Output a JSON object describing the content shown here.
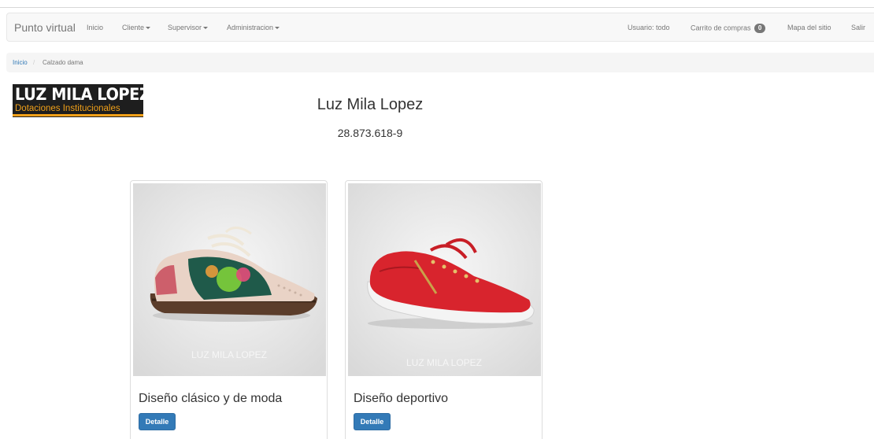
{
  "navbar": {
    "brand": "Punto virtual",
    "items": [
      {
        "label": "Inicio",
        "dropdown": false
      },
      {
        "label": "Cliente",
        "dropdown": true
      },
      {
        "label": "Supervisor",
        "dropdown": true
      },
      {
        "label": "Administracion",
        "dropdown": true
      }
    ],
    "right": {
      "user": "Usuario: todo",
      "cart_label": "Carrito de compras",
      "cart_count": "0",
      "sitemap": "Mapa del sitio",
      "logout": "Salir"
    }
  },
  "breadcrumb": {
    "home": "Inicio",
    "separator": "/",
    "current": "Calzado dama"
  },
  "logo": {
    "main": "LUZ MILA LOPEZ",
    "sub": "Dotaciones Institucionales"
  },
  "store": {
    "name": "Luz Mila Lopez",
    "nit": "28.873.618-9"
  },
  "products": [
    {
      "title": "Diseño clásico y de moda",
      "button": "Detalle",
      "watermark": "LUZ MILA LOPEZ"
    },
    {
      "title": "Diseño deportivo",
      "button": "Detalle",
      "watermark": "LUZ MILA LOPEZ"
    }
  ],
  "colors": {
    "primary": "#337ab7",
    "logo_accent": "#f0a019",
    "navbar_bg": "#f8f8f8"
  }
}
